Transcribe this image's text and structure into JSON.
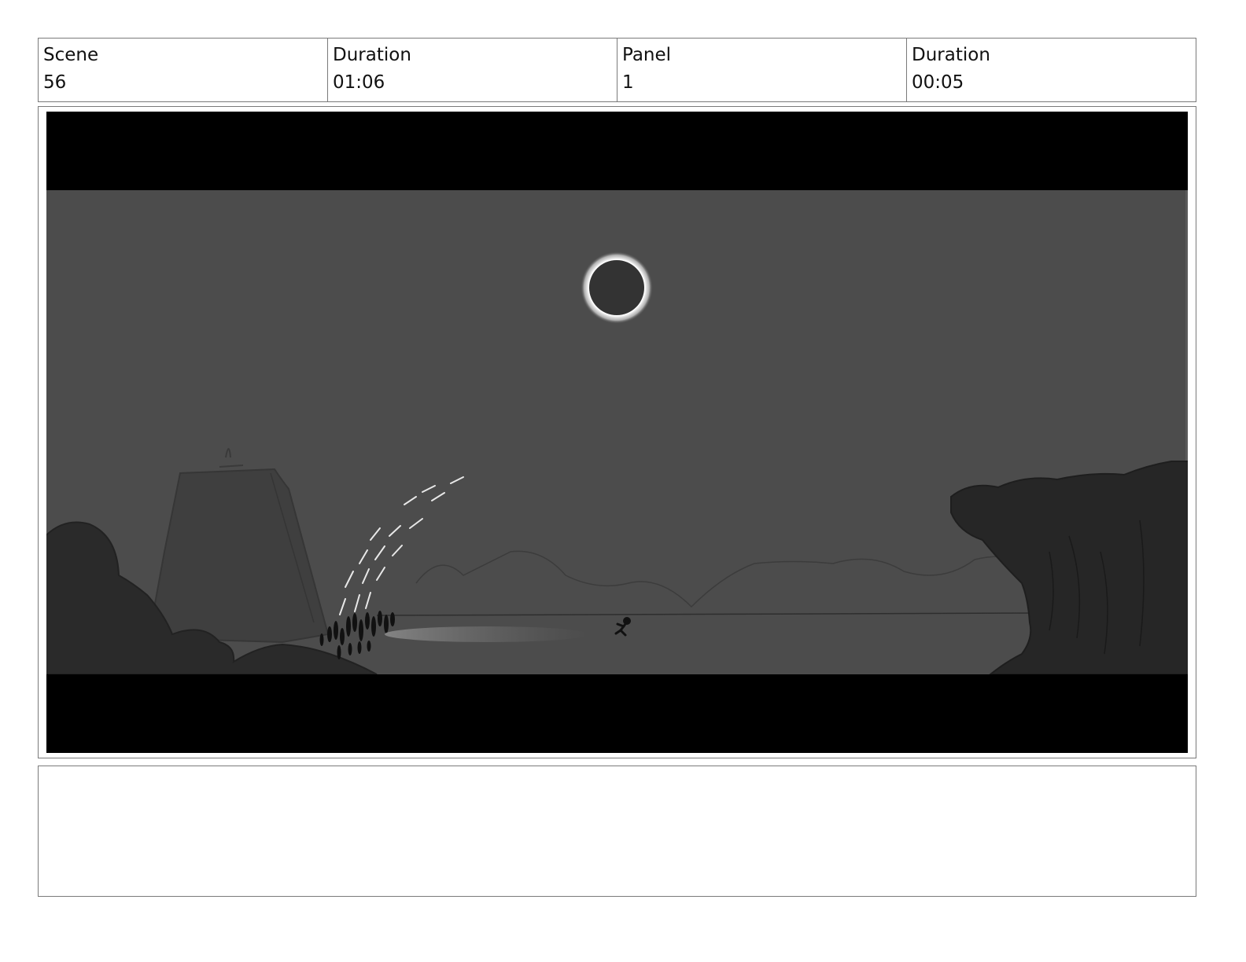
{
  "header": {
    "scene_label": "Scene",
    "scene_value": "56",
    "scene_duration_label": "Duration",
    "scene_duration_value": "01:06",
    "panel_label": "Panel",
    "panel_value": "1",
    "panel_duration_label": "Duration",
    "panel_duration_value": "00:05"
  },
  "notes": {
    "text": ""
  }
}
